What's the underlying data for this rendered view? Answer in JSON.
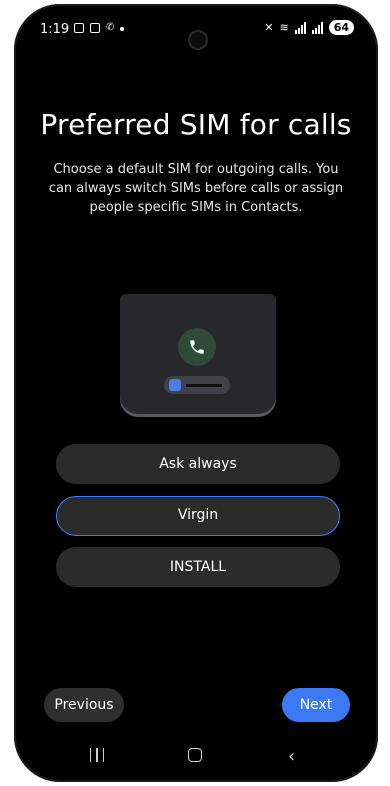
{
  "status_bar": {
    "time": "1:19",
    "battery": "64",
    "icons": [
      "screenshot-icon",
      "gallery-icon",
      "call-icon",
      "dot-icon",
      "mute-icon",
      "wifi-icon",
      "signal-icon",
      "signal-icon",
      "battery-icon"
    ]
  },
  "page": {
    "title": "Preferred SIM for calls",
    "description": "Choose a default SIM for outgoing calls. You can always switch SIMs before calls or assign people specific SIMs in Contacts."
  },
  "options": [
    {
      "label": "Ask always"
    },
    {
      "label": "Virgin",
      "selected": true
    },
    {
      "label": "INSTALL"
    }
  ],
  "footer": {
    "previous_label": "Previous",
    "next_label": "Next"
  },
  "colors": {
    "accent": "#3b79f5",
    "button_bg": "#2b2b2b",
    "background": "#000000"
  },
  "nav": {
    "icons": [
      "recents-icon",
      "home-icon",
      "back-icon"
    ]
  }
}
